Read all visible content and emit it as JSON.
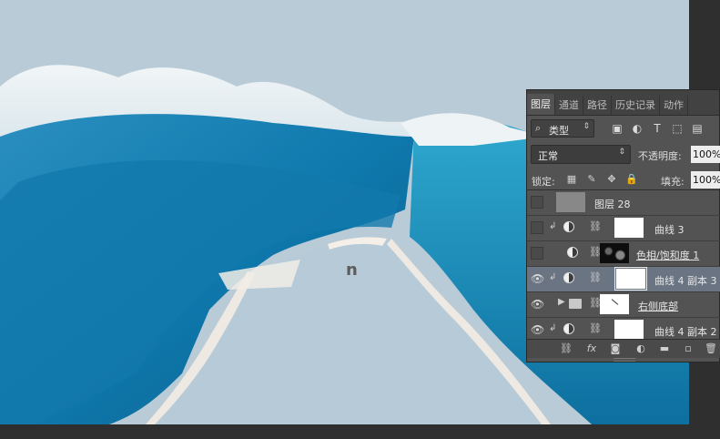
{
  "panel": {
    "tabs": [
      {
        "label": "图层"
      },
      {
        "label": "通道"
      },
      {
        "label": "路径"
      },
      {
        "label": "历史记录"
      },
      {
        "label": "动作"
      }
    ],
    "filter": {
      "search_icon": "search-icon",
      "kind_label": "类型"
    },
    "filter_icons": [
      "image-filter-icon",
      "adjustment-filter-icon",
      "type-filter-icon",
      "shape-filter-icon",
      "smart-object-filter-icon"
    ],
    "blend_mode": "正常",
    "opacity_label": "不透明度:",
    "opacity_value": "100%",
    "lock_label": "锁定:",
    "lock_icons": [
      "lock-transparent-icon",
      "lock-brush-icon",
      "lock-move-icon",
      "lock-all-icon"
    ],
    "fill_label": "填充:",
    "fill_value": "100%",
    "layers": [
      {
        "name": "图层 28",
        "visible": false,
        "thumb": "gray"
      },
      {
        "name": "曲线 3",
        "visible": false,
        "thumb": "white"
      },
      {
        "name": "色相/饱和度 1",
        "visible": false,
        "thumb": "dark"
      },
      {
        "name": "曲线 4 副本 3",
        "visible": true,
        "thumb": "white",
        "selected": true
      },
      {
        "name": "右侧底部",
        "visible": true,
        "thumb": "white",
        "group": true
      },
      {
        "name": "曲线 4 副本 2",
        "visible": true,
        "thumb": "white"
      }
    ],
    "bottom_icons": [
      "link-layers-icon",
      "fx-icon",
      "layer-mask-icon",
      "new-adjustment-icon",
      "new-group-icon",
      "new-layer-icon",
      "trash-icon"
    ],
    "fx_label": "fx"
  },
  "canvas": {
    "stray_text": "n"
  }
}
